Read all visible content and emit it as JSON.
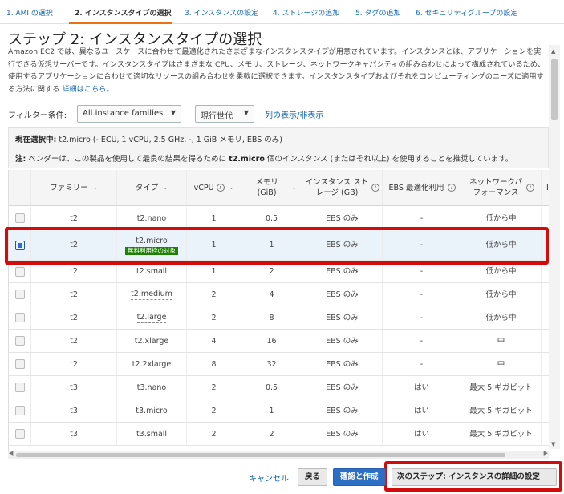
{
  "wizard": {
    "steps": [
      {
        "label": "1. AMI の選択"
      },
      {
        "label": "2. インスタンスタイプの選択"
      },
      {
        "label": "3. インスタンスの設定"
      },
      {
        "label": "4. ストレージの追加"
      },
      {
        "label": "5. タグの追加"
      },
      {
        "label": "6. セキュリティグループの設定"
      }
    ],
    "active_index": 1,
    "accent_color": "#ec7211"
  },
  "page": {
    "title": "ステップ 2: インスタンスタイプの選択",
    "description": "Amazon EC2 では、異なるユースケースに合わせて最適化されたさまざまなインスタンスタイプが用意されています。インスタンスとは、アプリケーションを実行できる仮想サーバーです。インスタンスタイプはさまざまな CPU、メモリ、ストレージ、ネットワークキャパシティの組み合わせによって構成されているため、使用するアプリケーションに合わせて適切なリソースの組み合わせを柔軟に選択できます。インスタンスタイプおよびそれをコンピューティングのニーズに適用する方法に関する",
    "learn_more": "詳細はこちら。"
  },
  "filter": {
    "label": "フィルター条件:",
    "family_select": "All instance families",
    "generation_select": "現行世代",
    "column_toggle": "列の表示/非表示"
  },
  "info": {
    "current_label": "現在選択中:",
    "current_value": "t2.micro (- ECU, 1 vCPU, 2.5 GHz, -, 1 GiB メモリ, EBS のみ)",
    "note_label": "注:",
    "note_before": "ベンダーは、この製品を使用して最良の結果を得るために",
    "note_type": "t2.micro",
    "note_after": "個のインスタンス (またはそれ以上) を使用することを推奨しています。"
  },
  "table": {
    "headers": {
      "family": "ファミリー",
      "type": "タイプ",
      "vcpu": "vCPU",
      "memory": "メモリ (GiB)",
      "storage": "インスタンス ストレージ (GB)",
      "ebs": "EBS 最適化利用",
      "network": "ネットワークパフォーマンス",
      "extra": "I"
    },
    "free_tier_badge": "無料利用枠の対象",
    "rows": [
      {
        "family": "t2",
        "type": "t2.nano",
        "vcpu": "1",
        "memory": "0.5",
        "storage": "EBS のみ",
        "ebs": "-",
        "network": "低から中"
      },
      {
        "family": "t2",
        "type": "t2.micro",
        "vcpu": "1",
        "memory": "1",
        "storage": "EBS のみ",
        "ebs": "-",
        "network": "低から中"
      },
      {
        "family": "t2",
        "type": "t2.small",
        "vcpu": "1",
        "memory": "2",
        "storage": "EBS のみ",
        "ebs": "-",
        "network": "低から中"
      },
      {
        "family": "t2",
        "type": "t2.medium",
        "vcpu": "2",
        "memory": "4",
        "storage": "EBS のみ",
        "ebs": "-",
        "network": "低から中"
      },
      {
        "family": "t2",
        "type": "t2.large",
        "vcpu": "2",
        "memory": "8",
        "storage": "EBS のみ",
        "ebs": "-",
        "network": "低から中"
      },
      {
        "family": "t2",
        "type": "t2.xlarge",
        "vcpu": "4",
        "memory": "16",
        "storage": "EBS のみ",
        "ebs": "-",
        "network": "中"
      },
      {
        "family": "t2",
        "type": "t2.2xlarge",
        "vcpu": "8",
        "memory": "32",
        "storage": "EBS のみ",
        "ebs": "-",
        "network": "中"
      },
      {
        "family": "t3",
        "type": "t3.nano",
        "vcpu": "2",
        "memory": "0.5",
        "storage": "EBS のみ",
        "ebs": "はい",
        "network": "最大 5 ギガビット"
      },
      {
        "family": "t3",
        "type": "t3.micro",
        "vcpu": "2",
        "memory": "1",
        "storage": "EBS のみ",
        "ebs": "はい",
        "network": "最大 5 ギガビット"
      },
      {
        "family": "t3",
        "type": "t3.small",
        "vcpu": "2",
        "memory": "2",
        "storage": "EBS のみ",
        "ebs": "はい",
        "network": "最大 5 ギガビット"
      }
    ],
    "selected_index": 1
  },
  "footer": {
    "cancel": "キャンセル",
    "back": "戻る",
    "review_launch": "確認と作成",
    "next": "次のステップ: インスタンスの詳細の設定"
  },
  "colors": {
    "highlight": "#d40b0b",
    "primary_button": "#2d6fc4",
    "free_tier": "#1d8102",
    "link": "#1166bb"
  }
}
